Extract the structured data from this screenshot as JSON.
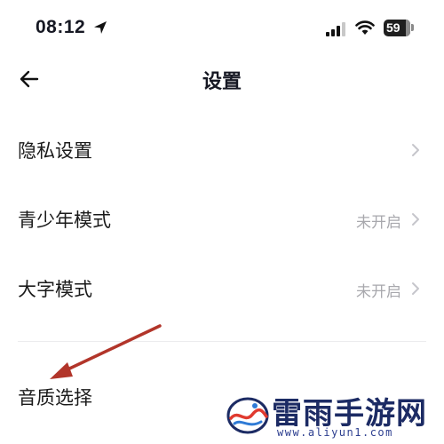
{
  "status_bar": {
    "time": "08:12",
    "battery": "59",
    "icons": [
      "location-arrow-icon",
      "signal-icon",
      "wifi-icon",
      "battery-icon"
    ]
  },
  "nav": {
    "title": "设置",
    "back_icon": "back-arrow-icon"
  },
  "settings": {
    "items": [
      {
        "label": "隐私设置",
        "value": ""
      },
      {
        "label": "青少年模式",
        "value": "未开启"
      },
      {
        "label": "大字模式",
        "value": "未开启"
      },
      {
        "label": "音质选择",
        "value": ""
      }
    ]
  },
  "annotation": {
    "arrow_color": "#b2352a"
  },
  "watermark": {
    "brand": "雷雨手游网",
    "url": "www.aliyun1.com"
  },
  "colors": {
    "text": "#161823",
    "muted": "#a8a8ad",
    "divider": "#ececee"
  }
}
